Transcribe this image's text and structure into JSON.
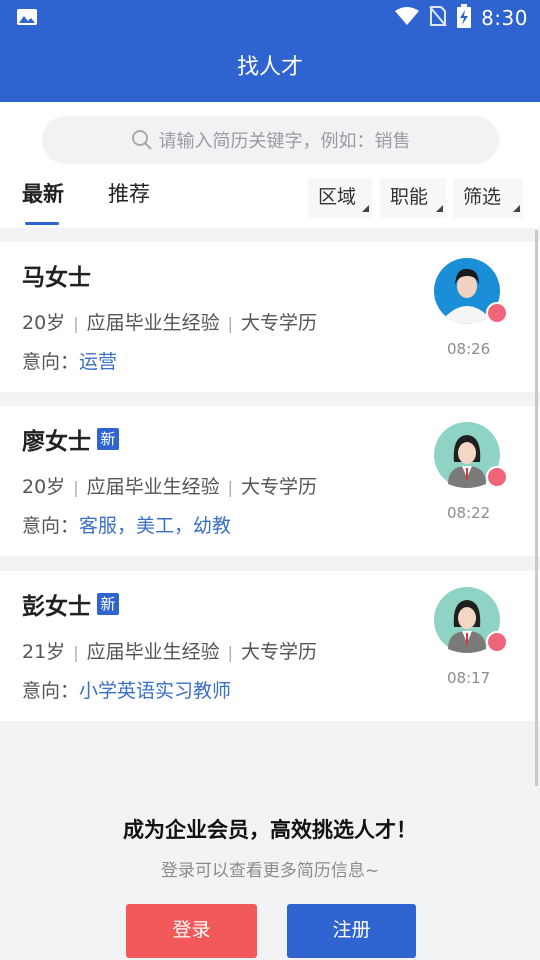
{
  "status": {
    "time": "8:30"
  },
  "header": {
    "title": "找人才"
  },
  "search": {
    "placeholder": "请输入简历关键字，例如：销售"
  },
  "tabs": [
    {
      "label": "最新"
    },
    {
      "label": "推荐"
    }
  ],
  "filters": [
    {
      "label": "区域"
    },
    {
      "label": "职能"
    },
    {
      "label": "筛选"
    }
  ],
  "candidates": [
    {
      "name": "马女士",
      "is_new": false,
      "age": "20岁",
      "experience": "应届毕业生经验",
      "education": "大专学历",
      "intent_label": "意向：",
      "intent": "运营",
      "time": "08:26",
      "avatar": "photo-avatar-icon"
    },
    {
      "name": "廖女士",
      "is_new": true,
      "badge": "新",
      "age": "20岁",
      "experience": "应届毕业生经验",
      "education": "大专学历",
      "intent_label": "意向：",
      "intent": "客服，美工，幼教",
      "time": "08:22",
      "avatar": "female-avatar-icon"
    },
    {
      "name": "彭女士",
      "is_new": true,
      "badge": "新",
      "age": "21岁",
      "experience": "应届毕业生经验",
      "education": "大专学历",
      "intent_label": "意向：",
      "intent": "小学英语实习教师",
      "time": "08:17",
      "avatar": "female-avatar-icon"
    }
  ],
  "cta": {
    "title": "成为企业会员，高效挑选人才！",
    "subtitle": "登录可以查看更多简历信息~",
    "login_label": "登录",
    "register_label": "注册"
  },
  "colors": {
    "primary": "#2f63cf",
    "login": "#f2595b",
    "link": "#3a6fc6"
  }
}
